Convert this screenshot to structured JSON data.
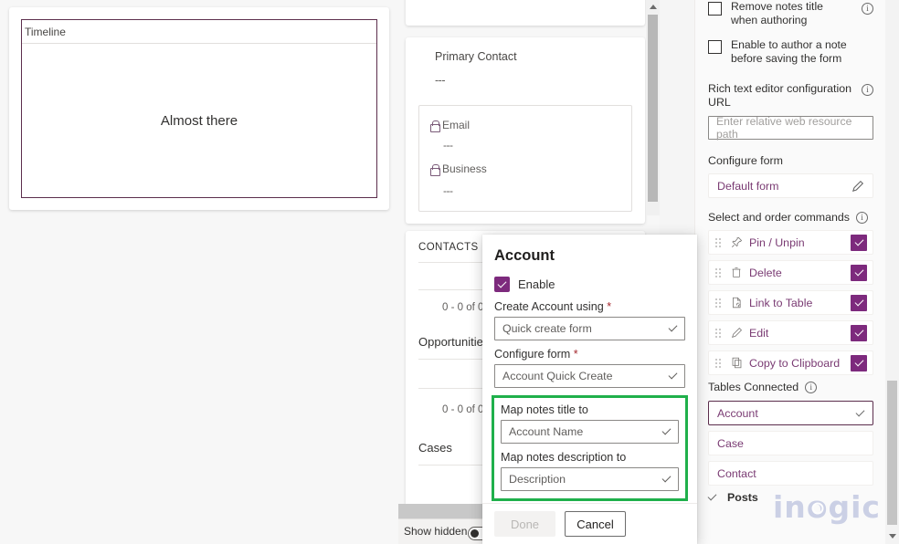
{
  "left_canvas": {
    "timeline": {
      "header_label": "Timeline",
      "empty_message": "Almost there"
    }
  },
  "middle_canvas": {
    "primary_contact": {
      "label": "Primary Contact",
      "value": "---",
      "fields": [
        {
          "icon": "lock-icon",
          "label": "Email",
          "value": "---"
        },
        {
          "icon": "lock-icon",
          "label": "Business",
          "value": "---"
        }
      ]
    },
    "sections": [
      {
        "title": "CONTACTS",
        "count": "0 - 0 of 0"
      },
      {
        "title": "Opportunities",
        "count": "0 - 0 of 0"
      },
      {
        "title": "Cases",
        "count": ""
      }
    ],
    "footer": {
      "show_hidden_label": "Show hidden",
      "show_hidden_on": false
    }
  },
  "right_panel": {
    "checkboxes": [
      {
        "label": "Remove notes title when authoring",
        "checked": false,
        "has_info": true
      },
      {
        "label": "Enable to author a note before saving the form",
        "checked": false,
        "has_info": false
      }
    ],
    "rich_text": {
      "label": "Rich text editor configuration URL",
      "has_info": true,
      "placeholder": "Enter relative web resource path",
      "value": ""
    },
    "configure_form": {
      "label": "Configure form",
      "value": "Default form",
      "edit_icon": "pencil-icon"
    },
    "commands_section": {
      "label": "Select and order commands",
      "has_info": true,
      "items": [
        {
          "icon": "pin-icon",
          "label": "Pin / Unpin",
          "checked": true
        },
        {
          "icon": "trash-icon",
          "label": "Delete",
          "checked": true
        },
        {
          "icon": "link-to-table-icon",
          "label": "Link to Table",
          "checked": true
        },
        {
          "icon": "pencil-icon",
          "label": "Edit",
          "checked": true
        },
        {
          "icon": "copy-icon",
          "label": "Copy to Clipboard",
          "checked": true
        }
      ]
    },
    "tables_connected": {
      "label": "Tables Connected",
      "has_info": true,
      "items": [
        {
          "label": "Account",
          "selected": true,
          "expanded": true
        },
        {
          "label": "Case",
          "selected": false,
          "expanded": false
        },
        {
          "label": "Contact",
          "selected": false,
          "expanded": false
        }
      ]
    },
    "posts": {
      "label": "Posts",
      "expanded": false
    }
  },
  "dialog": {
    "title": "Account",
    "enable": {
      "label": "Enable",
      "checked": true
    },
    "fields": [
      {
        "label": "Create Account using",
        "required": true,
        "value": "Quick create form",
        "highlighted": false
      },
      {
        "label": "Configure form",
        "required": true,
        "value": "Account Quick Create",
        "highlighted": false
      },
      {
        "label": "Map notes title to",
        "required": false,
        "value": "Account Name",
        "highlighted": true
      },
      {
        "label": "Map notes description to",
        "required": false,
        "value": "Description",
        "highlighted": true
      }
    ],
    "buttons": {
      "done": "Done",
      "cancel": "Cancel"
    },
    "done_enabled": false
  },
  "watermark": {
    "text": "inogic"
  },
  "colors": {
    "accent_purple": "#7d2a7d",
    "link_purple": "#7a3b73",
    "highlight_green": "#1fb04b",
    "required_red": "#a4262c",
    "form_border_purple": "#5c2e4d"
  }
}
